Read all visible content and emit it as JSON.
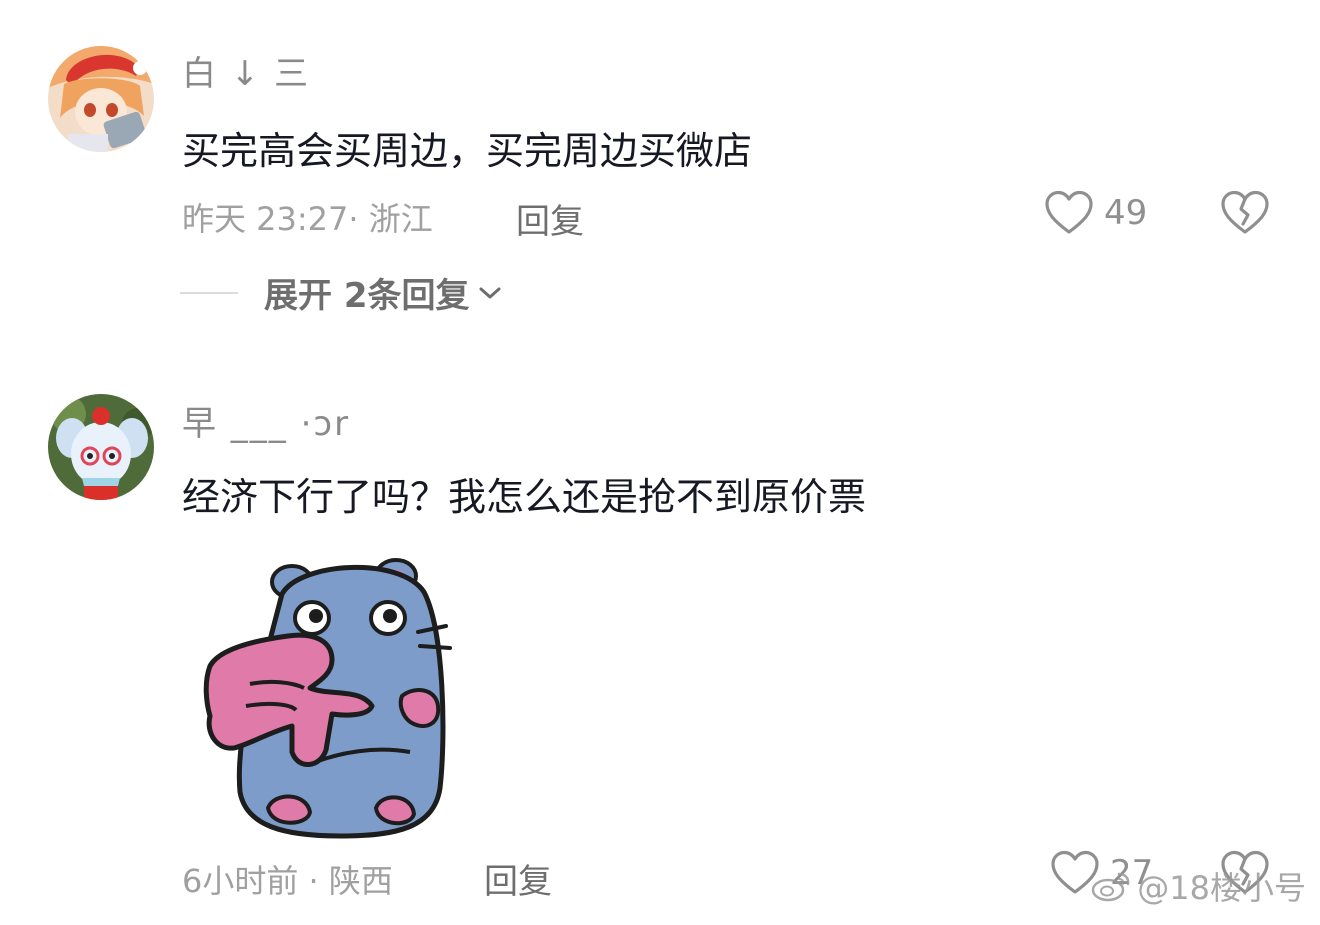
{
  "comments": [
    {
      "username": "白 ↓ 三",
      "text": "买完高会买周边，买完周边买微店",
      "meta": "昨天 23:27· 浙江",
      "reply_label": "回复",
      "likes": "49",
      "expand_label": "展开 2条回复"
    },
    {
      "username": "早 ___ ·ɔr",
      "text": "经济下行了吗？我怎么还是抢不到原价票",
      "meta": "6小时前 · 陕西",
      "reply_label": "回复",
      "likes": "27"
    }
  ],
  "watermark": "@18楼小号",
  "icons": {
    "like": "heart-outline-icon",
    "dislike": "broken-heart-icon",
    "expand": "chevron-down-icon",
    "watermark": "weibo-logo-icon"
  },
  "colors": {
    "text": "#161823",
    "meta": "#a0a0a0",
    "reply": "#6e6e6e",
    "sticker_body": "#7d9cc9",
    "sticker_hand": "#e07aa8"
  }
}
